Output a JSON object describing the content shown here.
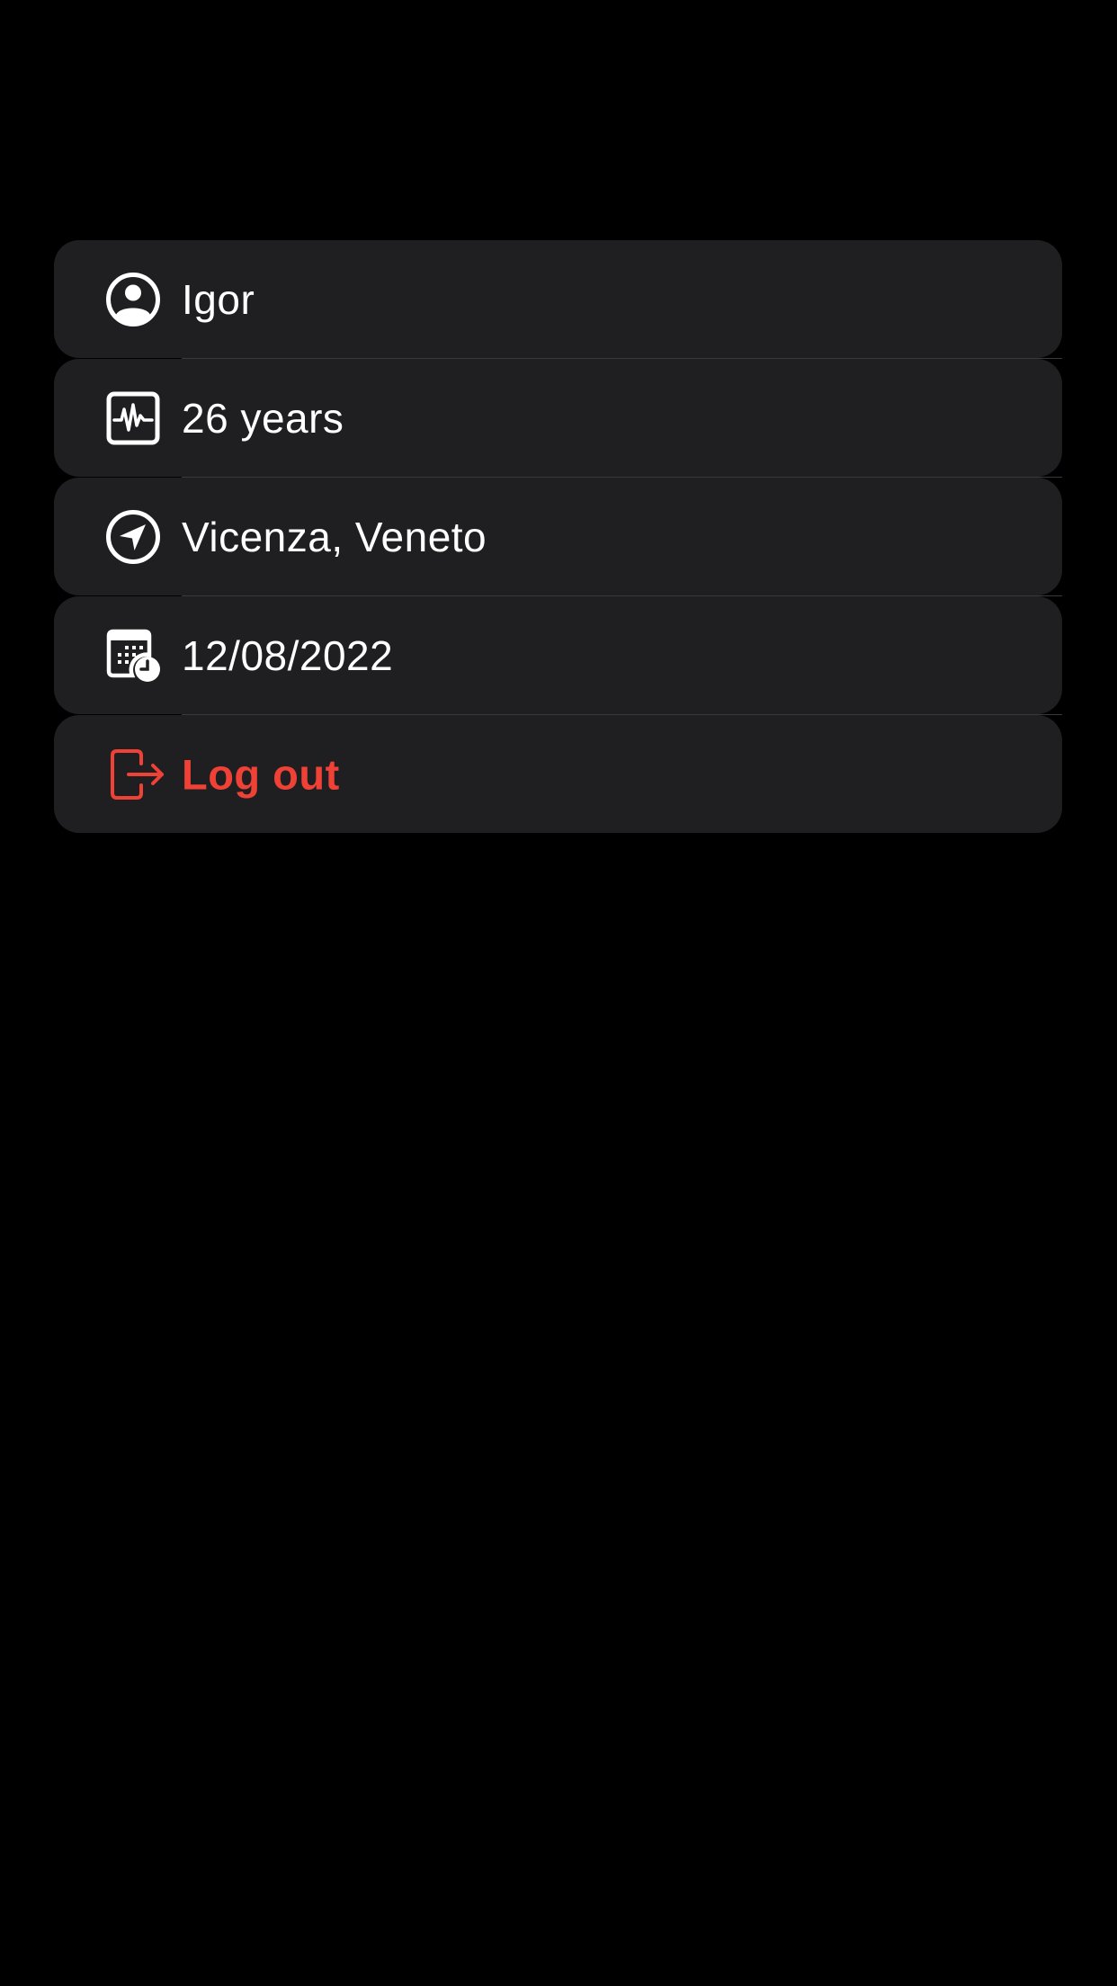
{
  "profile": {
    "name": "Igor",
    "age": "26 years",
    "location": "Vicenza, Veneto",
    "date": "12/08/2022"
  },
  "actions": {
    "logout_label": "Log out"
  },
  "icons": {
    "name": "person-circle-icon",
    "age": "waveform-monitor-icon",
    "location": "location-arrow-icon",
    "date": "calendar-clock-icon",
    "logout": "logout-arrow-icon"
  },
  "colors": {
    "background": "#000000",
    "card": "#1f1f21",
    "text": "#ffffff",
    "logout": "#ef4136",
    "divider": "#3a3a3c"
  }
}
